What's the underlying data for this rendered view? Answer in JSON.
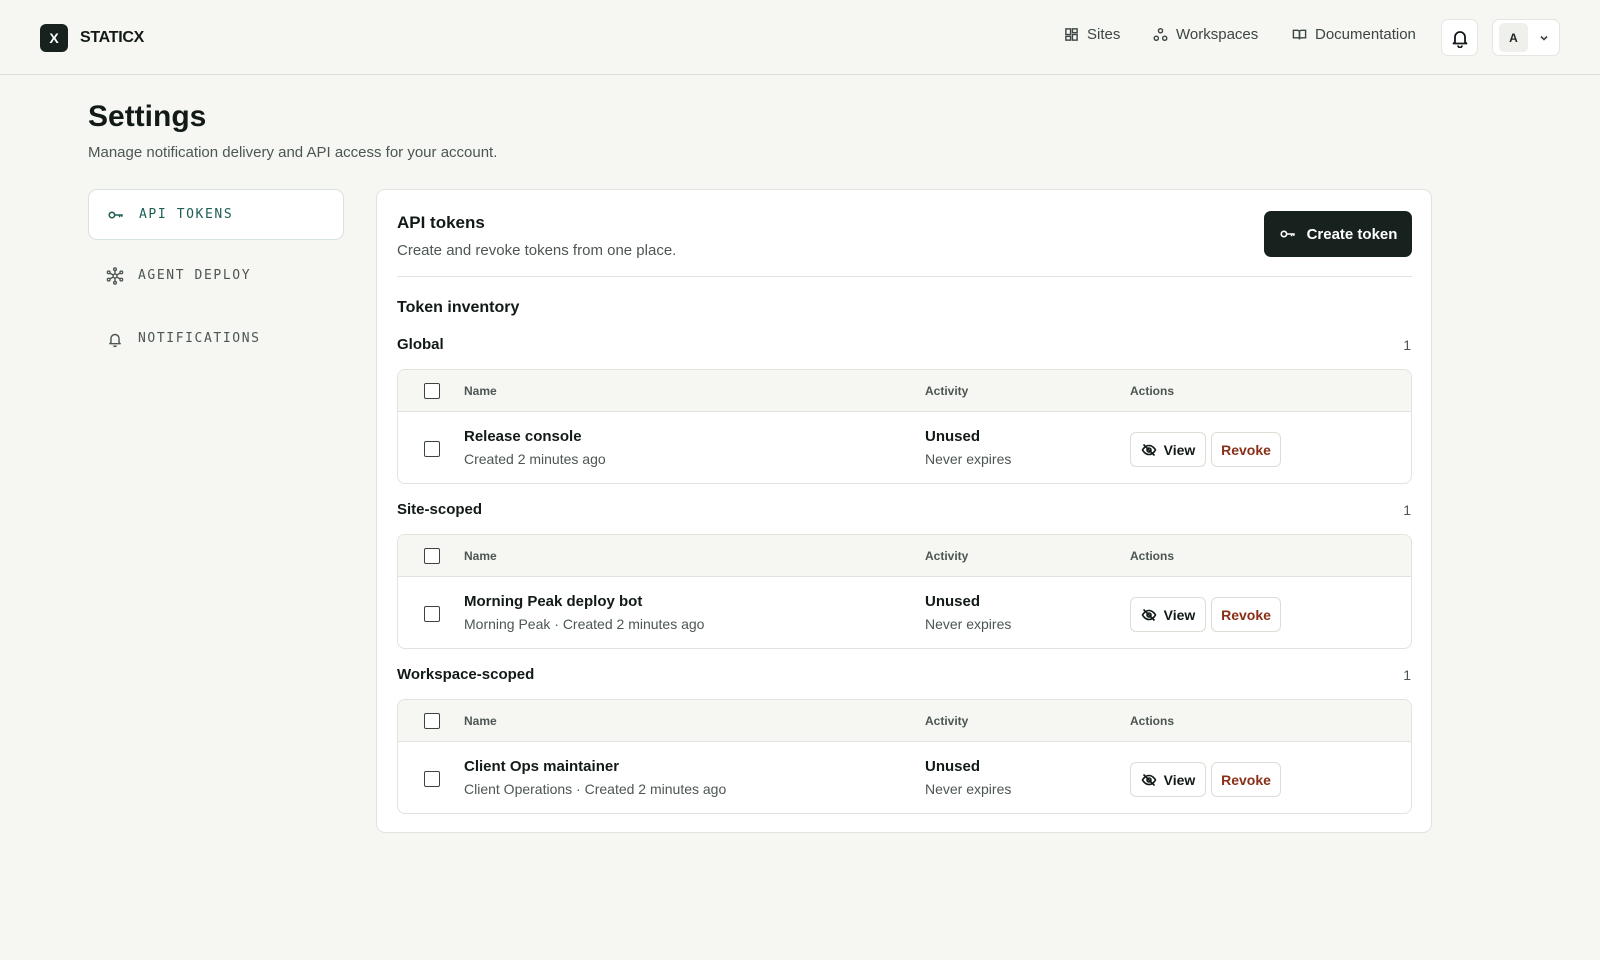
{
  "brand": {
    "logo_letter": "X",
    "name": "STATICX"
  },
  "nav": {
    "items": [
      {
        "label": "Sites",
        "icon": "grid-icon"
      },
      {
        "label": "Workspaces",
        "icon": "workspaces-icon"
      },
      {
        "label": "Documentation",
        "icon": "book-icon"
      }
    ],
    "notifications_icon": "bell-icon",
    "user": {
      "initial": "A",
      "menu_icon": "chevron-down-icon"
    }
  },
  "page": {
    "title": "Settings",
    "subtitle": "Manage notification delivery and API access for your account."
  },
  "sidebar": {
    "items": [
      {
        "label": "API TOKENS",
        "icon": "key-icon",
        "active": true
      },
      {
        "label": "AGENT DEPLOY",
        "icon": "network-icon",
        "active": false
      },
      {
        "label": "NOTIFICATIONS",
        "icon": "bell-icon",
        "active": false
      }
    ]
  },
  "panel": {
    "title": "API tokens",
    "subtitle": "Create and revoke tokens from one place.",
    "create_label": "Create token",
    "inventory_title": "Token inventory",
    "columns": {
      "name": "Name",
      "activity": "Activity",
      "actions": "Actions"
    },
    "groups": [
      {
        "label": "Global",
        "count": "1",
        "rows": [
          {
            "name": "Release console",
            "meta": "Created 2 minutes ago",
            "status": "Unused",
            "expiry": "Never expires",
            "view_label": "View",
            "revoke_label": "Revoke"
          }
        ]
      },
      {
        "label": "Site-scoped",
        "count": "1",
        "rows": [
          {
            "name": "Morning Peak deploy bot",
            "meta": "Morning Peak · Created 2 minutes ago",
            "status": "Unused",
            "expiry": "Never expires",
            "view_label": "View",
            "revoke_label": "Revoke"
          }
        ]
      },
      {
        "label": "Workspace-scoped",
        "count": "1",
        "rows": [
          {
            "name": "Client Ops maintainer",
            "meta": "Client Operations · Created 2 minutes ago",
            "status": "Unused",
            "expiry": "Never expires",
            "view_label": "View",
            "revoke_label": "Revoke"
          }
        ]
      }
    ]
  },
  "colors": {
    "background": "#f6f6f3",
    "primary_dark": "#17221f",
    "active_teal": "#1d5e55",
    "revoke_red": "#8a2f17"
  }
}
